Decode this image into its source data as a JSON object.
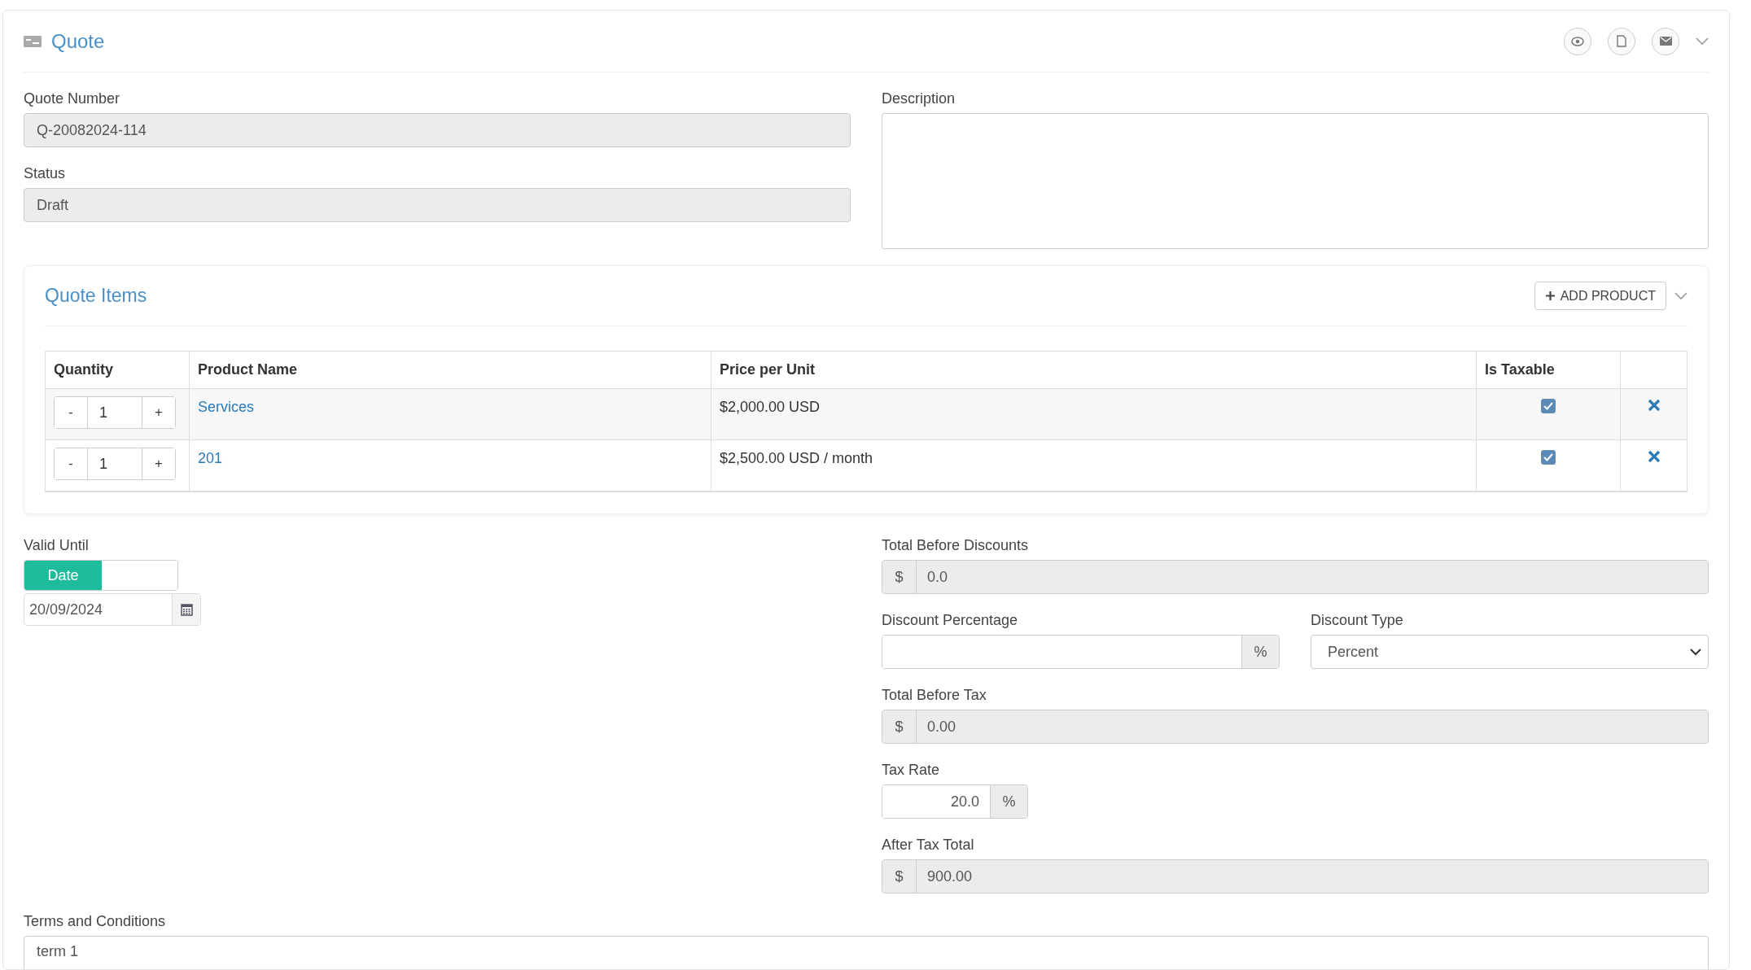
{
  "header": {
    "title": "Quote"
  },
  "quote_number": {
    "label": "Quote Number",
    "value": "Q-20082024-114"
  },
  "status": {
    "label": "Status",
    "value": "Draft"
  },
  "description": {
    "label": "Description"
  },
  "quote_items": {
    "title": "Quote Items",
    "add_button": "ADD PRODUCT",
    "columns": [
      "Quantity",
      "Product Name",
      "Price per Unit",
      "Is Taxable"
    ],
    "rows": [
      {
        "minus": "-",
        "quantity": "1",
        "plus": "+",
        "product": "Services",
        "price": "$2,000.00 USD",
        "taxable": true
      },
      {
        "minus": "-",
        "quantity": "1",
        "plus": "+",
        "product": "201",
        "price": "$2,500.00 USD / month",
        "taxable": true
      }
    ]
  },
  "valid_until": {
    "label": "Valid Until",
    "toggle": [
      {
        "label": "Date",
        "selected": true
      }
    ],
    "date": "20/09/2024"
  },
  "total_before_discounts": {
    "label": "Total Before Discounts",
    "prefix": "$",
    "value": "0.0"
  },
  "discount_percentage": {
    "label": "Discount Percentage",
    "suffix": "%"
  },
  "discount_type": {
    "label": "Discount Type",
    "value": "Percent"
  },
  "total_before_tax": {
    "label": "Total Before Tax",
    "prefix": "$",
    "value": "0.00"
  },
  "tax_rate": {
    "label": "Tax Rate",
    "value": "20.0",
    "suffix": "%"
  },
  "after_tax_total": {
    "label": "After Tax Total",
    "prefix": "$",
    "value": "900.00"
  },
  "terms": {
    "label": "Terms and Conditions",
    "value": "term 1"
  }
}
